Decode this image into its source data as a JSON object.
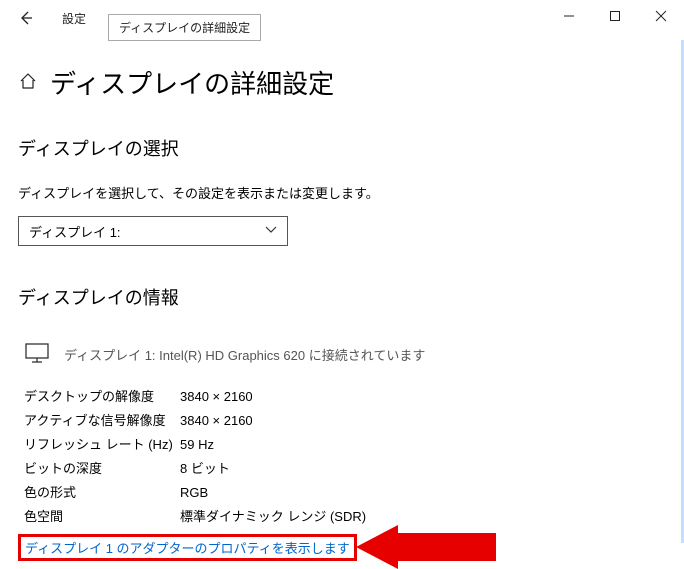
{
  "titlebar": {
    "app_title": "設定",
    "tooltip": "ディスプレイの詳細設定"
  },
  "page": {
    "title": "ディスプレイの詳細設定"
  },
  "select_section": {
    "title": "ディスプレイの選択",
    "help": "ディスプレイを選択して、その設定を表示または変更します。",
    "dropdown_value": "ディスプレイ 1:"
  },
  "info_section": {
    "title": "ディスプレイの情報",
    "connection": "ディスプレイ 1: Intel(R) HD Graphics 620 に接続されています",
    "rows": [
      {
        "label": "デスクトップの解像度",
        "value": "3840 × 2160"
      },
      {
        "label": "アクティブな信号解像度",
        "value": "3840 × 2160"
      },
      {
        "label": "リフレッシュ レート (Hz)",
        "value": "59 Hz"
      },
      {
        "label": "ビットの深度",
        "value": "8 ビット"
      },
      {
        "label": "色の形式",
        "value": "RGB"
      },
      {
        "label": "色空間",
        "value": "標準ダイナミック レンジ (SDR)"
      }
    ],
    "adapter_link": "ディスプレイ 1 のアダプターのプロパティを表示します"
  }
}
